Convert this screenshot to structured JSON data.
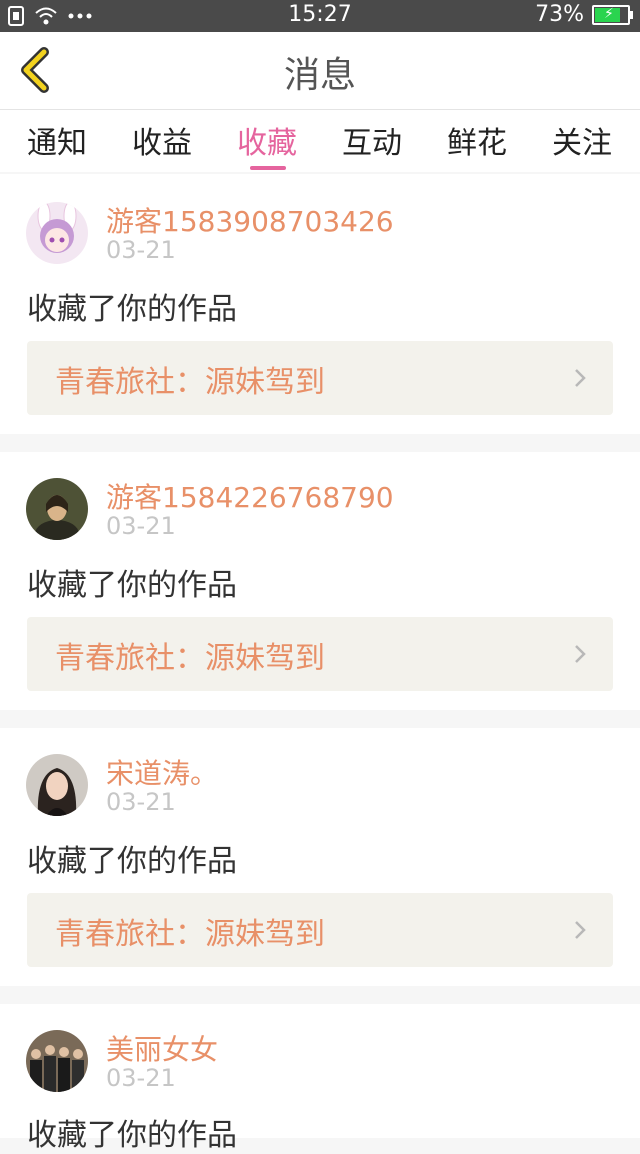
{
  "status_bar": {
    "time": "15:27",
    "battery": "73%",
    "battery_level": 0.73,
    "icons": [
      "sim-icon",
      "wifi-icon",
      "more-dots-icon",
      "battery-icon"
    ]
  },
  "header": {
    "title": "消息",
    "back_icon": "chevron-left-icon",
    "accent_color": "#f2d21f"
  },
  "tabs": [
    {
      "label": "通知",
      "active": false
    },
    {
      "label": "收益",
      "active": false
    },
    {
      "label": "收藏",
      "active": true
    },
    {
      "label": "互动",
      "active": false
    },
    {
      "label": "鲜花",
      "active": false
    },
    {
      "label": "关注",
      "active": false
    }
  ],
  "colors": {
    "active_tab": "#e5649e",
    "username": "#e89068",
    "date": "#c6c6c6"
  },
  "messages": [
    {
      "username": "游客1583908703426",
      "date": "03-21",
      "action": "收藏了你的作品",
      "work_title": "青春旅社：源妹驾到",
      "avatar": "anime-girl-avatar"
    },
    {
      "username": "游客1584226768790",
      "date": "03-21",
      "action": "收藏了你的作品",
      "work_title": "青春旅社：源妹驾到",
      "avatar": "portrait-painting-avatar"
    },
    {
      "username": "宋道涛。",
      "date": "03-21",
      "action": "收藏了你的作品",
      "work_title": "青春旅社：源妹驾到",
      "avatar": "woman-photo-avatar"
    },
    {
      "username": "美丽女女",
      "date": "03-21",
      "action": "收藏了你的作品",
      "work_title": "",
      "avatar": "group-photo-avatar"
    }
  ]
}
